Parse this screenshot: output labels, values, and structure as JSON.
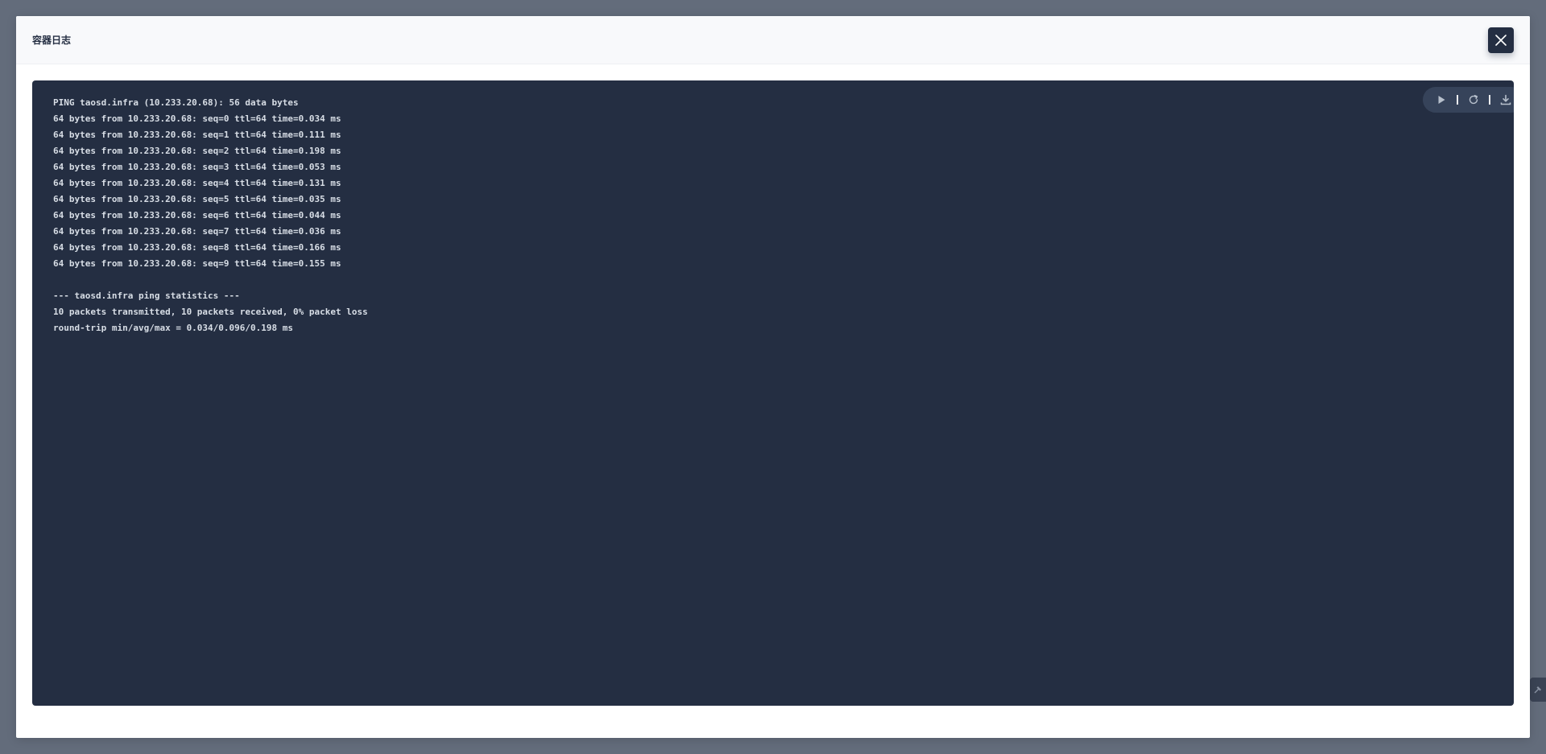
{
  "modal": {
    "title": "容器日志"
  },
  "icons": {
    "close": "close-icon",
    "play": "play-icon",
    "refresh": "refresh-icon",
    "download": "download-icon"
  },
  "colors": {
    "backdrop": "#636c7b",
    "terminal_bg": "#242e42",
    "terminal_text": "#d8dee6",
    "toolbar_bg": "#36435a",
    "header_bg": "#f8f9fb"
  },
  "log": {
    "lines": [
      "PING taosd.infra (10.233.20.68): 56 data bytes",
      "64 bytes from 10.233.20.68: seq=0 ttl=64 time=0.034 ms",
      "64 bytes from 10.233.20.68: seq=1 ttl=64 time=0.111 ms",
      "64 bytes from 10.233.20.68: seq=2 ttl=64 time=0.198 ms",
      "64 bytes from 10.233.20.68: seq=3 ttl=64 time=0.053 ms",
      "64 bytes from 10.233.20.68: seq=4 ttl=64 time=0.131 ms",
      "64 bytes from 10.233.20.68: seq=5 ttl=64 time=0.035 ms",
      "64 bytes from 10.233.20.68: seq=6 ttl=64 time=0.044 ms",
      "64 bytes from 10.233.20.68: seq=7 ttl=64 time=0.036 ms",
      "64 bytes from 10.233.20.68: seq=8 ttl=64 time=0.166 ms",
      "64 bytes from 10.233.20.68: seq=9 ttl=64 time=0.155 ms",
      "",
      "--- taosd.infra ping statistics ---",
      "10 packets transmitted, 10 packets received, 0% packet loss",
      "round-trip min/avg/max = 0.034/0.096/0.198 ms"
    ]
  }
}
